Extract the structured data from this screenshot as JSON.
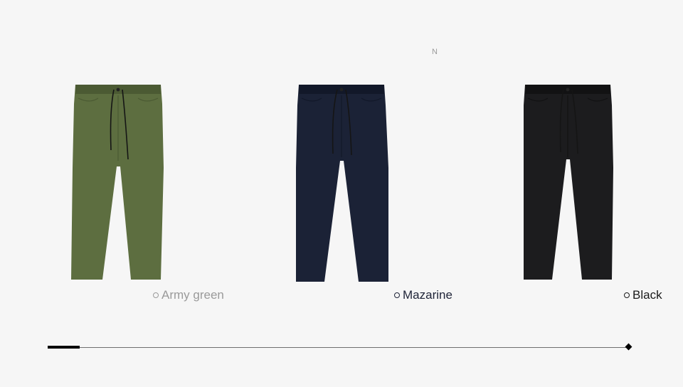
{
  "header": {
    "letter": "N"
  },
  "products": [
    {
      "color_name": "Army green",
      "fabric_color": "#5d6e40",
      "shade_color": "#4b5a33"
    },
    {
      "color_name": "Mazarine",
      "fabric_color": "#1b2236",
      "shade_color": "#121829"
    },
    {
      "color_name": "Black",
      "fabric_color": "#1c1c1e",
      "shade_color": "#121213"
    }
  ],
  "slider": {
    "position": 0.0
  }
}
